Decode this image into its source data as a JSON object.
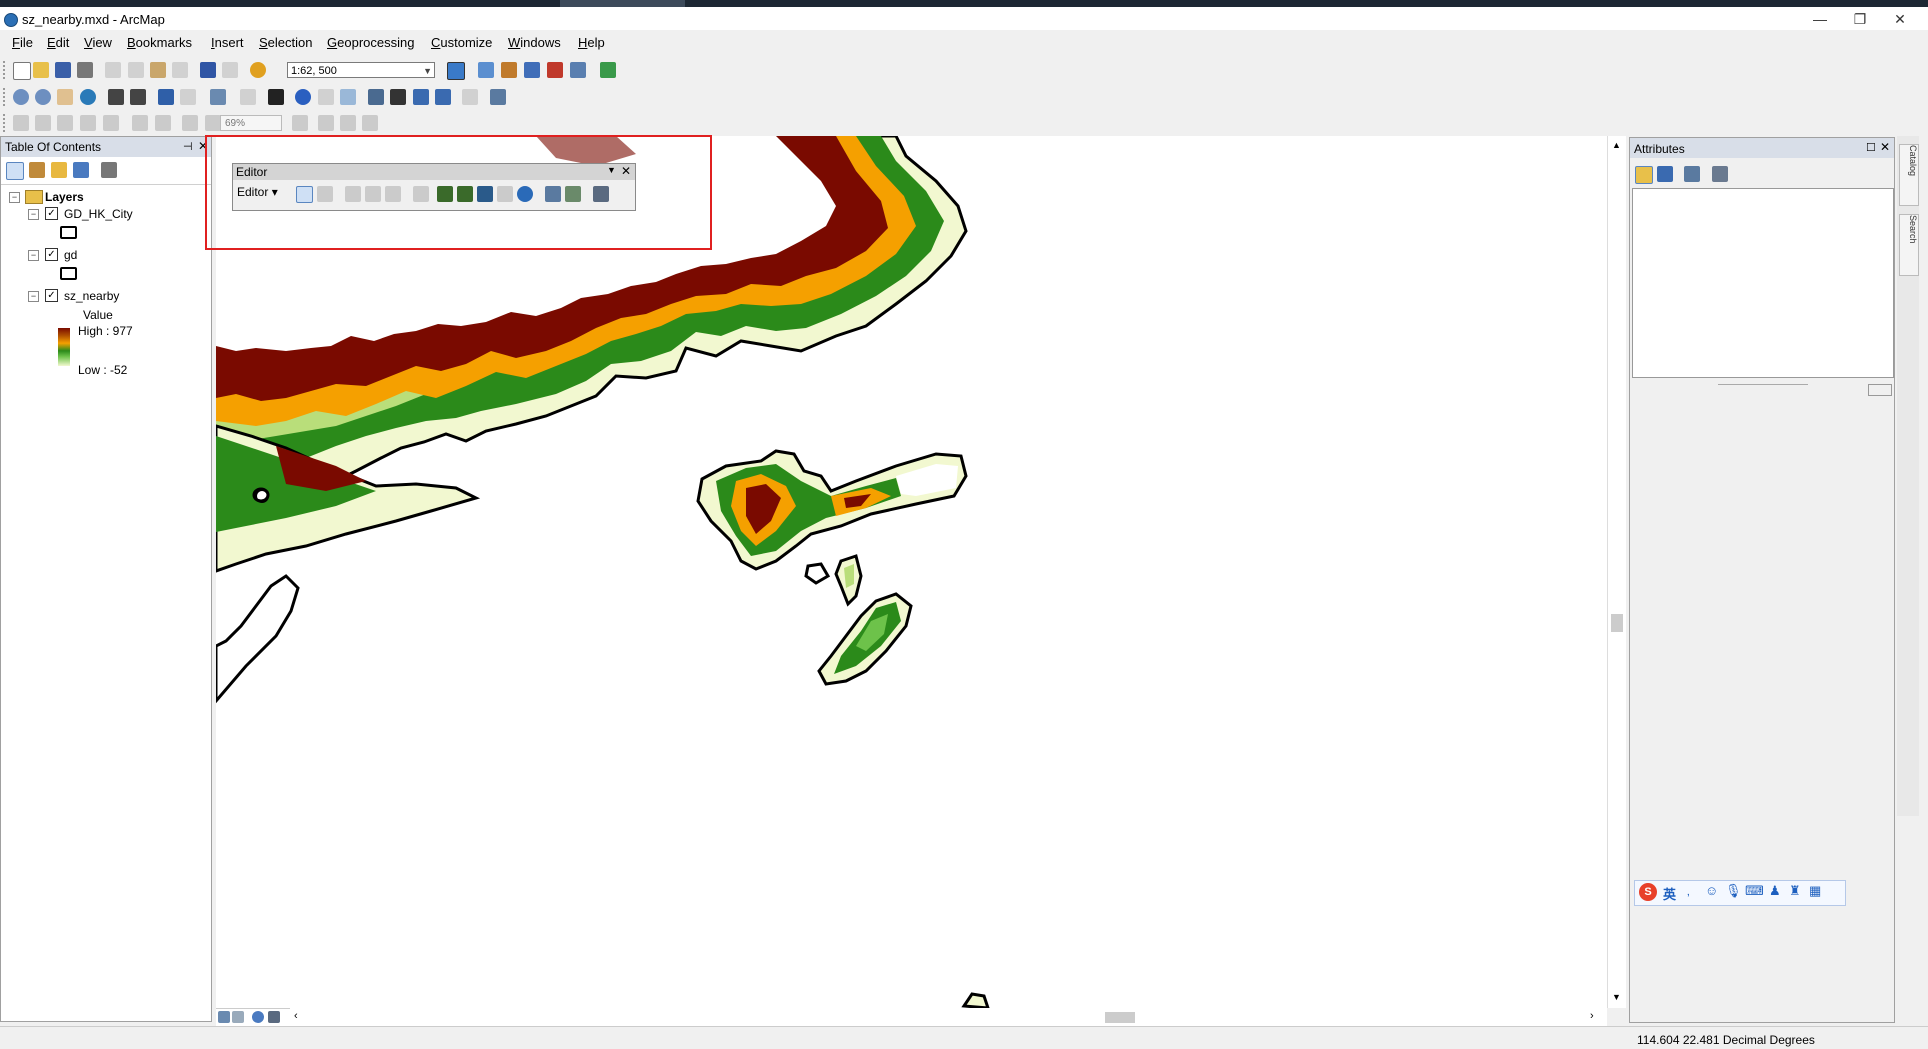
{
  "window": {
    "title": "sz_nearby.mxd - ArcMap",
    "controls": [
      "—",
      "❐",
      "✕"
    ]
  },
  "menu": [
    "File",
    "Edit",
    "View",
    "Bookmarks",
    "Insert",
    "Selection",
    "Geoprocessing",
    "Customize",
    "Windows",
    "Help"
  ],
  "toolbar": {
    "scale": "1:62, 500",
    "zoom_percent": "69%"
  },
  "toc": {
    "title": "Table Of Contents",
    "root": "Layers",
    "layers": [
      {
        "name": "GD_HK_City",
        "checked": true
      },
      {
        "name": "gd",
        "checked": true
      },
      {
        "name": "sz_nearby",
        "checked": true,
        "legend_field": "Value",
        "high": "High : 977",
        "low": "Low : -52"
      }
    ]
  },
  "editor": {
    "title": "Editor",
    "menu_label": "Editor"
  },
  "attributes": {
    "title": "Attributes"
  },
  "side_tabs": [
    "Catalog",
    "Search"
  ],
  "ime": {
    "lang": "英"
  },
  "status": {
    "coordinates": "114.604  22.481 Decimal Degrees"
  },
  "colors": {
    "elevation_high": "#7a0a00",
    "elevation_mid": "#f5a000",
    "elevation_low": "#2b8a1a",
    "elevation_lowest": "#f2f8d0",
    "highlight": "#e02020"
  }
}
